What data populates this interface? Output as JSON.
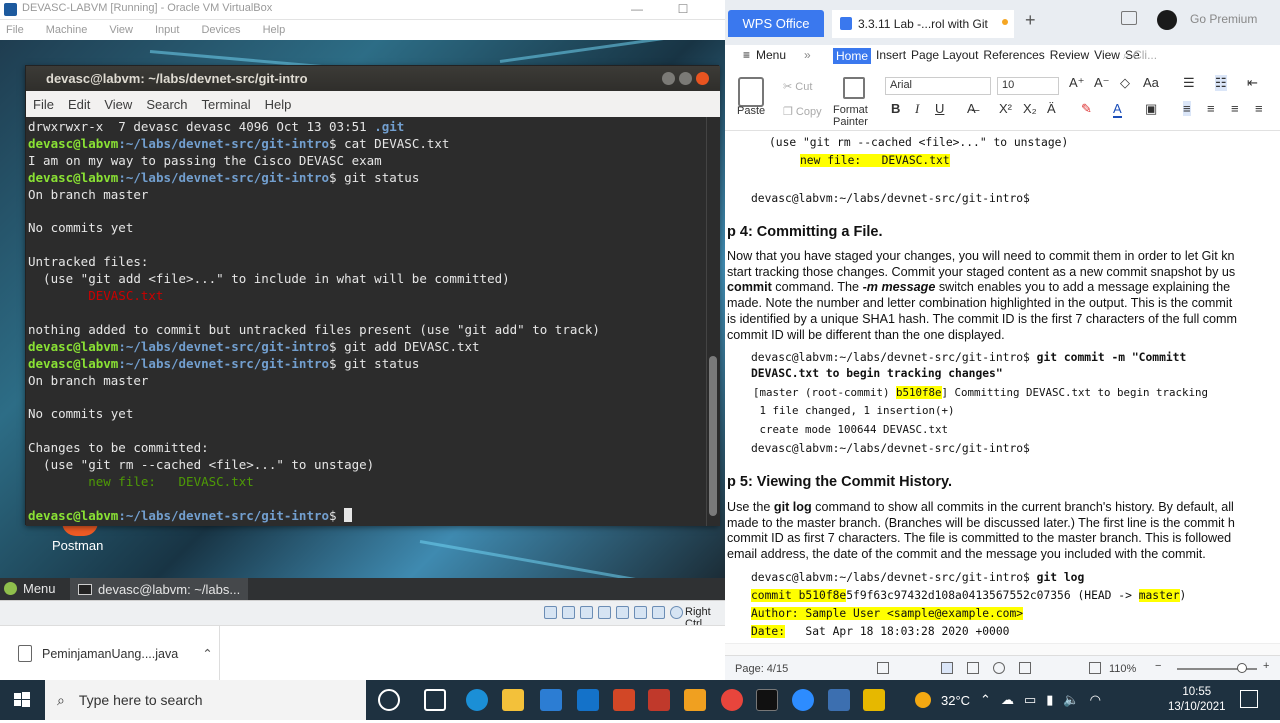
{
  "vbox": {
    "title": "DEVASC-LABVM [Running] - Oracle VM VirtualBox",
    "menu": [
      "File",
      "Machine",
      "View",
      "Input",
      "Devices",
      "Help"
    ],
    "right_ctrl": "Right Ctrl"
  },
  "terminal": {
    "title": "devasc@labvm: ~/labs/devnet-src/git-intro",
    "menu": [
      "File",
      "Edit",
      "View",
      "Search",
      "Terminal",
      "Help"
    ],
    "prompt_user": "devasc@labvm",
    "prompt_path": ":~/labs/devnet-src/git-intro",
    "line1": "drwxrwxr-x  7 devasc devasc 4096 Oct 13 03:51 ",
    "line1_dir": ".git",
    "cmd1": "$ cat DEVASC.txt",
    "out1": "I am on my way to passing the Cisco DEVASC exam",
    "cmd2": "$ git status",
    "out_branch": "On branch master",
    "out_nocommits": "No commits yet",
    "out_untracked": "Untracked files:",
    "out_untracked_hint": "  (use \"git add <file>...\" to include in what will be committed)",
    "out_untracked_file": "        DEVASC.txt",
    "out_nothing": "nothing added to commit but untracked files present (use \"git add\" to track)",
    "cmd3": "$ git add DEVASC.txt",
    "cmd4": "$ git status",
    "out_branch2": "On branch master",
    "out_nocommits2": "No commits yet",
    "out_changes": "Changes to be committed:",
    "out_changes_hint": "  (use \"git rm --cached <file>...\" to unstage)",
    "out_newfile": "        new file:   DEVASC.txt",
    "cmd5": "$ "
  },
  "desktop": {
    "postman_label": "Postman"
  },
  "vm_taskbar": {
    "menu_label": "Menu",
    "task_label": "devasc@labvm: ~/labs..."
  },
  "download": {
    "file": "PeminjamanUang....java"
  },
  "wps": {
    "office_tab": "WPS Office",
    "doc_tab": "3.3.11 Lab -...rol with Git",
    "go_premium": "Go Premium",
    "menu_label": "Menu",
    "ribbon_tabs": [
      "Home",
      "Insert",
      "Page Layout",
      "References",
      "Review",
      "View",
      "Se"
    ],
    "search_label": "Cli...",
    "toolbar": {
      "paste": "Paste",
      "cut": "Cut",
      "copy": "Copy",
      "format_painter_1": "Format",
      "format_painter_2": "Painter",
      "font": "Arial",
      "size": "10"
    },
    "status_page": "Page: 4/15",
    "zoom": "110%"
  },
  "doc": {
    "l1": "(use \"git rm --cached <file>...\" to unstage)",
    "l2": "new file:   DEVASC.txt",
    "l3": "devasc@labvm:~/labs/devnet-src/git-intro$",
    "h4": "p 4: Committing a File.",
    "p4_1": "Now that you have staged your changes, you will need to commit them in order to let Git kn",
    "p4_2": "start tracking those changes. Commit your staged content as a new commit snapshot by us",
    "p4_3a": "commit",
    "p4_3b": " command. The ",
    "p4_3c": "-m message",
    "p4_3d": " switch enables you to add a message explaining the",
    "p4_4": "made. Note the number and letter combination highlighted in the output. This is the commit",
    "p4_5": "is identified by a unique SHA1 hash. The commit ID is the first 7 characters of the full comm",
    "p4_6": "commit ID will be different than the one displayed.",
    "c1a": "devasc@labvm:~/labs/devnet-src/git-intro$ ",
    "c1b": "git commit -m \"Committ",
    "c1c": "DEVASC.txt to begin tracking changes\"",
    "c2a": "[master (root-commit) ",
    "c2b": "b510f8e",
    "c2c": "] Committing DEVASC.txt to begin tracking",
    "c3": " 1 file changed, 1 insertion(+)",
    "c4": " create mode 100644 DEVASC.txt",
    "c5": "devasc@labvm:~/labs/devnet-src/git-intro$",
    "h5": "p 5: Viewing the Commit History.",
    "p5_1a": "Use the ",
    "p5_1b": "git log",
    "p5_1c": " command to show all commits in the current branch's history. By default, all",
    "p5_2": "made to the master branch. (Branches will be discussed later.) The first line is the commit h",
    "p5_3": "commit ID as first 7 characters. The file is committed to the master branch. This is followed",
    "p5_4": "email address, the date of the commit and the message you included with the commit.",
    "g1a": "devasc@labvm:~/labs/devnet-src/git-intro$ ",
    "g1b": "git log",
    "g2a": "commit b510f8e",
    "g2b": "5f9f63c97432d108a0413567552c07356 (HEAD -> ",
    "g2c": "master",
    "g2d": ")",
    "g3": "Author: Sample User <sample@example.com>",
    "g4a": "Date:",
    "g4b": "   Sat Apr 18 18:03:28 2020 +0000"
  },
  "taskbar": {
    "search_placeholder": "Type here to search",
    "temp": "32°C",
    "time": "10:55",
    "date": "13/10/2021"
  }
}
